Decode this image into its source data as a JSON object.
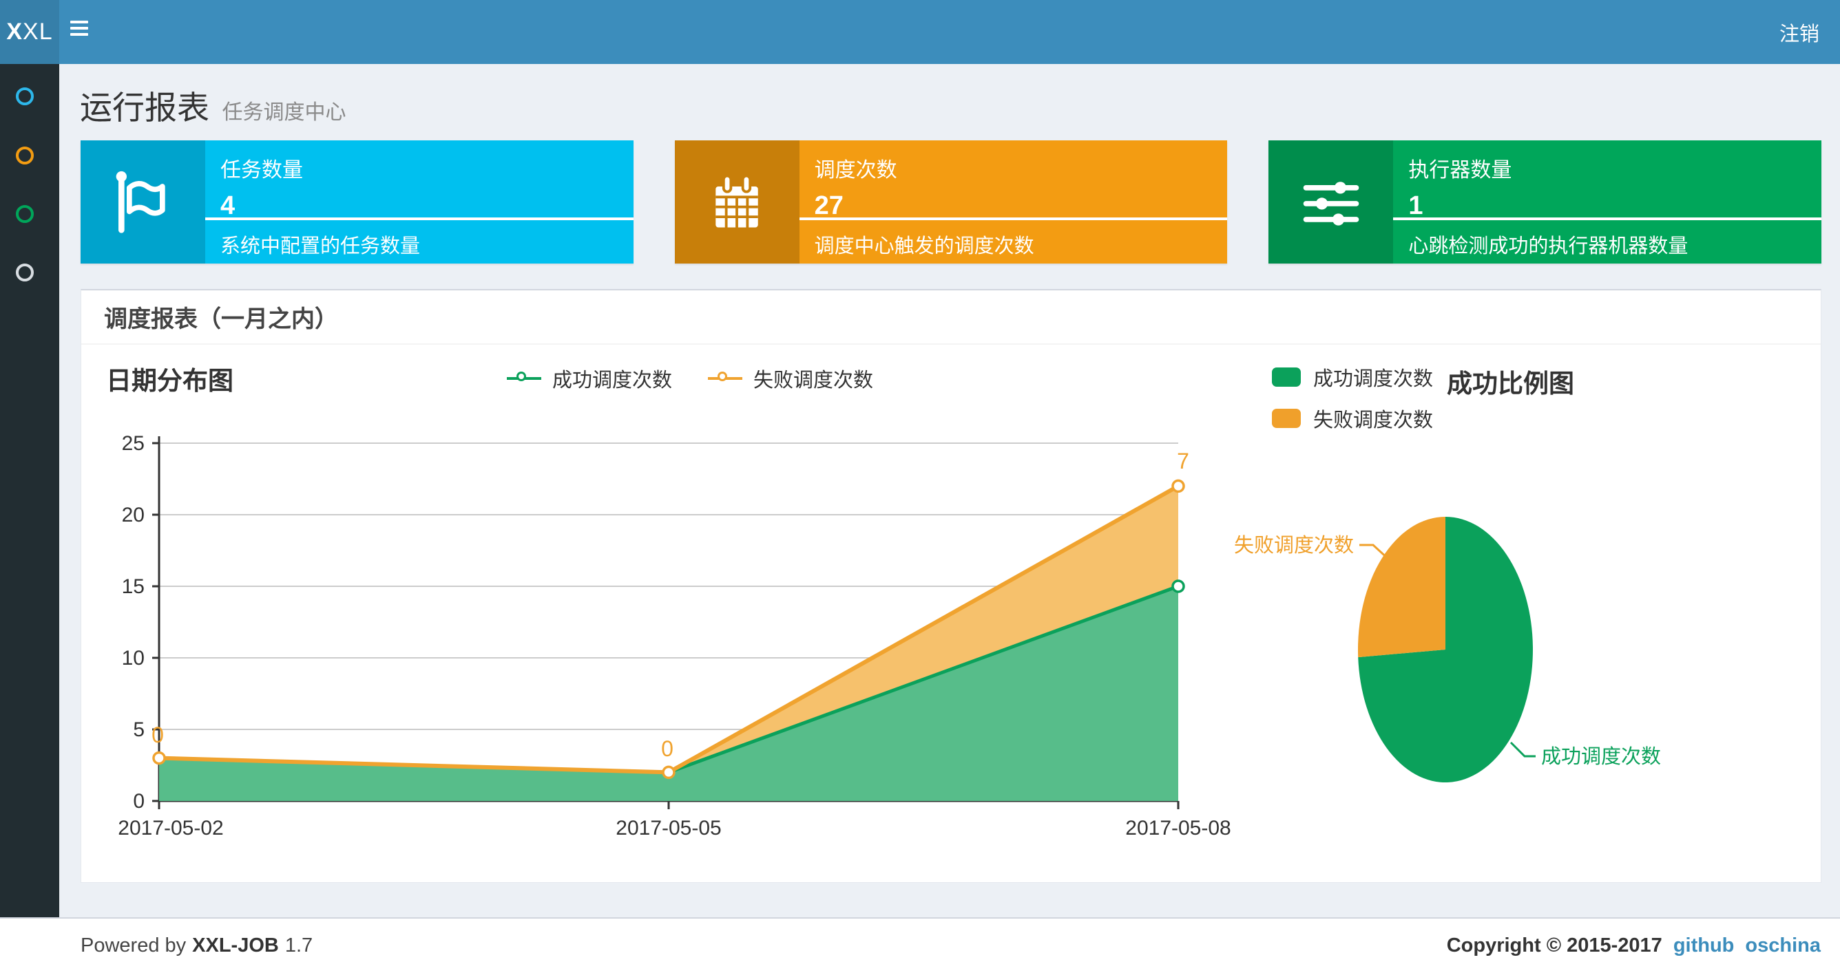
{
  "navbar": {
    "logo_bold": "X",
    "logo_rest": "XL",
    "logout_label": "注销"
  },
  "colors": {
    "navbar": "#3c8dbc",
    "logo_bg": "#367fa9",
    "sidebar": "#222d32",
    "content_bg": "#ecf0f5",
    "success_green": "#0ba15b",
    "success_fill": "#57bd8a",
    "fail_orange": "#f0a32f",
    "fail_fill": "#f6c16c"
  },
  "sidebar": {
    "items": [
      {
        "icon": "circle-outline-icon",
        "color": "#2db7ea"
      },
      {
        "icon": "circle-outline-icon",
        "color": "#f39c12"
      },
      {
        "icon": "circle-outline-icon",
        "color": "#00a65a"
      },
      {
        "icon": "circle-outline-icon",
        "color": "#d8dde2"
      }
    ]
  },
  "header": {
    "title": "运行报表",
    "subtitle": "任务调度中心"
  },
  "info_boxes": [
    {
      "title": "任务数量",
      "value": "4",
      "desc": "系统中配置的任务数量",
      "color": "#00c0ef",
      "icon_bg": "#00a3cc",
      "icon": "flag-icon"
    },
    {
      "title": "调度次数",
      "value": "27",
      "desc": "调度中心触发的调度次数",
      "color": "#f39c12",
      "icon_bg": "#c87f0a",
      "icon": "calendar-icon"
    },
    {
      "title": "执行器数量",
      "value": "1",
      "desc": "心跳检测成功的执行器机器数量",
      "color": "#00a65a",
      "icon_bg": "#008d4c",
      "icon": "sliders-icon"
    }
  ],
  "panel": {
    "title": "调度报表（一月之内）"
  },
  "chart_data": [
    {
      "type": "area",
      "title": "日期分布图",
      "x": [
        "2017-05-02",
        "2017-05-05",
        "2017-05-08"
      ],
      "series": [
        {
          "name": "成功调度次数",
          "values": [
            3,
            2,
            15
          ],
          "color": "#0ba15b",
          "fill": "#57bd8a"
        },
        {
          "name": "失败调度次数",
          "values": [
            0,
            0,
            7
          ],
          "stacked_totals": [
            3,
            2,
            22
          ],
          "color": "#f0a32f",
          "fill": "#f6c16c",
          "point_labels": [
            "0",
            "0",
            "7"
          ]
        }
      ],
      "stacked": true,
      "grid": true,
      "legend_position": "top-center",
      "ylim": [
        0,
        25
      ],
      "yticks": [
        0,
        5,
        10,
        15,
        20,
        25
      ]
    },
    {
      "type": "pie",
      "title": "成功比例图",
      "slices": [
        {
          "label": "成功调度次数",
          "value": 20,
          "color": "#0ba15b"
        },
        {
          "label": "失败调度次数",
          "value": 7,
          "color": "#f0a02b"
        }
      ],
      "legend_position": "top-left"
    }
  ],
  "footer": {
    "powered_prefix": "Powered by",
    "product": "XXL-JOB",
    "version": "1.7",
    "copyright": "Copyright © 2015-2017",
    "links": [
      {
        "label": "github"
      },
      {
        "label": "oschina"
      }
    ]
  }
}
